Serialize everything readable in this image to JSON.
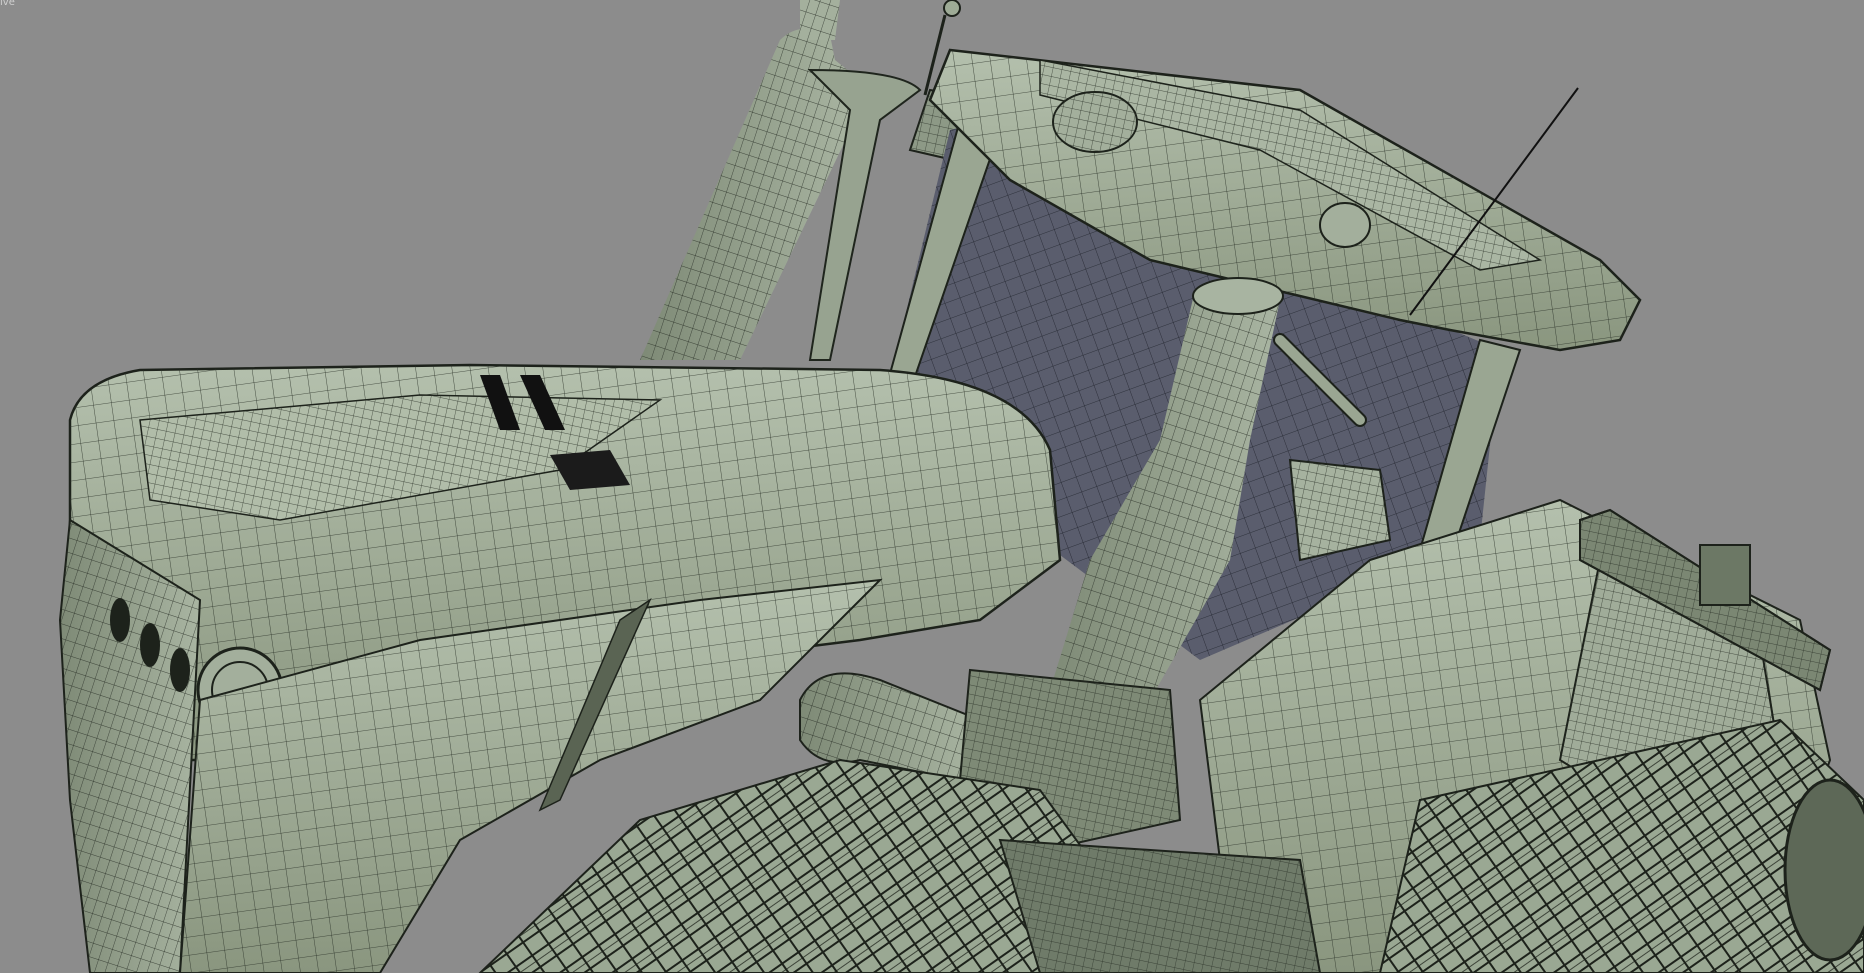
{
  "viewport": {
    "label": "ive",
    "background": "#8c8c8c",
    "model_fill": "#9eab96",
    "model_shadow": "#6f7b69",
    "wire_color": "#1f251d",
    "glass_color": "#55586a"
  }
}
